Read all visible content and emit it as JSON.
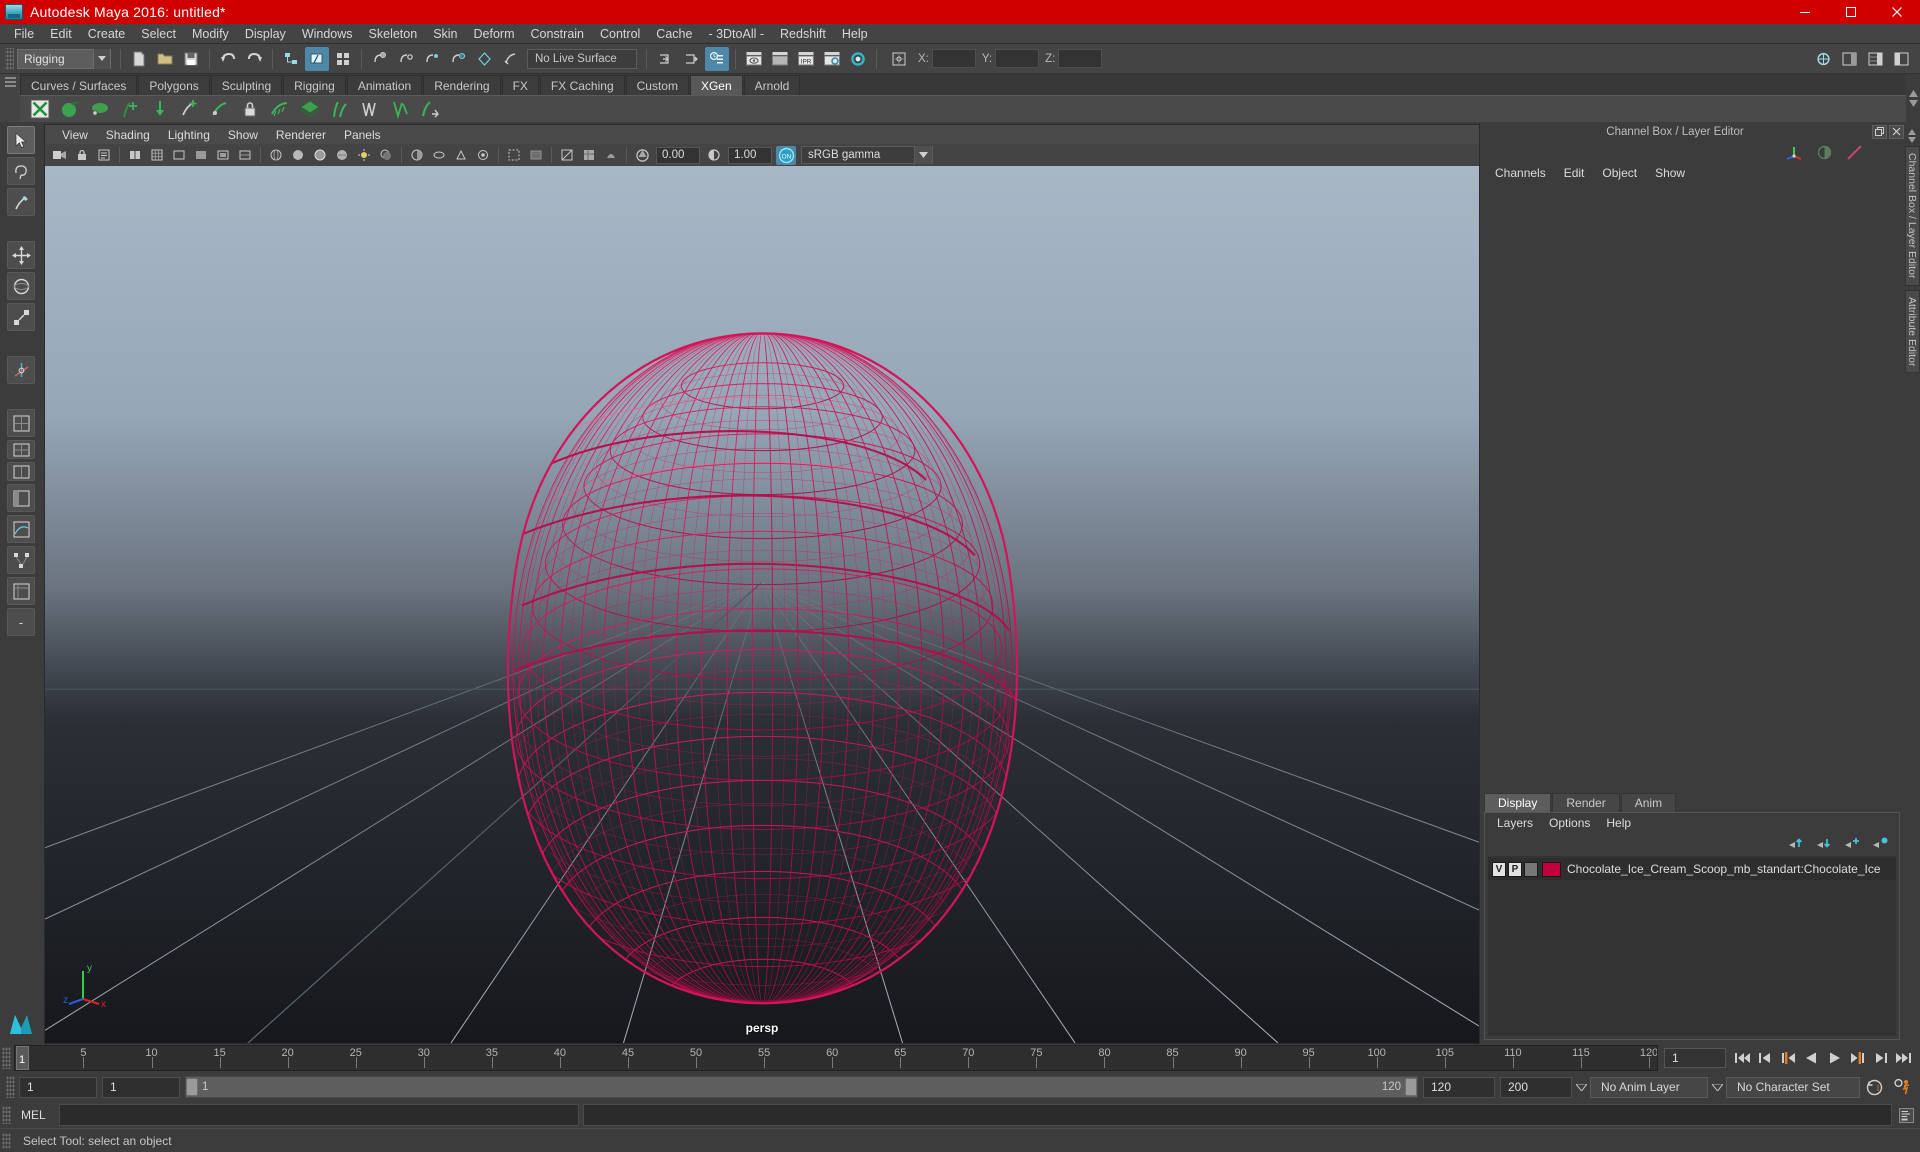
{
  "window": {
    "title": "Autodesk Maya 2016: untitled*",
    "app_icon": "maya-icon",
    "controls": {
      "minimize": "minimize-icon",
      "maximize": "maximize-icon",
      "close": "close-icon"
    },
    "titlebar_color": "#d00000"
  },
  "menubar": {
    "items": [
      "File",
      "Edit",
      "Create",
      "Select",
      "Modify",
      "Display",
      "Windows",
      "Skeleton",
      "Skin",
      "Deform",
      "Constrain",
      "Control",
      "Cache",
      "- 3DtoAll -",
      "Redshift",
      "Help"
    ]
  },
  "statusline": {
    "menu_set": "Rigging",
    "live_surface": "No Live Surface",
    "coords": {
      "x_label": "X:",
      "y_label": "Y:",
      "z_label": "Z:",
      "x": "",
      "y": "",
      "z": ""
    }
  },
  "shelf": {
    "tabs": [
      "Curves / Surfaces",
      "Polygons",
      "Sculpting",
      "Rigging",
      "Animation",
      "Rendering",
      "FX",
      "FX Caching",
      "Custom",
      "XGen",
      "Arnold"
    ],
    "active_tab": "XGen"
  },
  "viewport": {
    "menus": [
      "View",
      "Shading",
      "Lighting",
      "Show",
      "Renderer",
      "Panels"
    ],
    "exposure": "0.00",
    "gamma": "1.00",
    "color_profile": "sRGB gamma",
    "camera_label": "persp",
    "mesh_wireframe_color": "#d4145a",
    "axis": {
      "x": "x",
      "y": "y",
      "z": "z"
    }
  },
  "channel_box": {
    "panel_title": "Channel Box / Layer Editor",
    "menus": [
      "Channels",
      "Edit",
      "Object",
      "Show"
    ]
  },
  "layer_editor": {
    "tabs": [
      "Display",
      "Render",
      "Anim"
    ],
    "active_tab": "Display",
    "menus": [
      "Layers",
      "Options",
      "Help"
    ],
    "layers": [
      {
        "visibility": "V",
        "playback": "P",
        "third": "",
        "color": "#c2003c",
        "name": "Chocolate_Ice_Cream_Scoop_mb_standart:Chocolate_Ice"
      }
    ]
  },
  "side_tabs": [
    "Channel Box / Layer Editor",
    "Attribute Editor"
  ],
  "timeslider": {
    "ticks": [
      5,
      10,
      15,
      20,
      25,
      30,
      35,
      40,
      45,
      50,
      55,
      60,
      65,
      70,
      75,
      80,
      85,
      90,
      95,
      100,
      105,
      110,
      115,
      120
    ],
    "current_frame_marker": "1",
    "end_label": "120",
    "current_frame_field": "1",
    "playback_buttons": [
      "go-to-start-icon",
      "step-back-keyframe-icon",
      "step-back-frame-icon",
      "play-backwards-icon",
      "play-forwards-icon",
      "step-forward-frame-icon",
      "step-forward-keyframe-icon",
      "go-to-end-icon"
    ]
  },
  "range": {
    "anim_start": "1",
    "range_start": "1",
    "slider_min_label": "1",
    "slider_max_label": "120",
    "range_end": "120",
    "anim_end": "200",
    "anim_layer": "No Anim Layer",
    "character_set": "No Character Set",
    "auto_keyframe_icon": "auto-keyframe-icon",
    "animation_prefs_icon": "animation-preferences-icon"
  },
  "command_line": {
    "language_label": "MEL",
    "input_value": "",
    "output_value": "",
    "script_editor_icon": "script-editor-icon"
  },
  "helpline": {
    "text": "Select Tool: select an object"
  }
}
